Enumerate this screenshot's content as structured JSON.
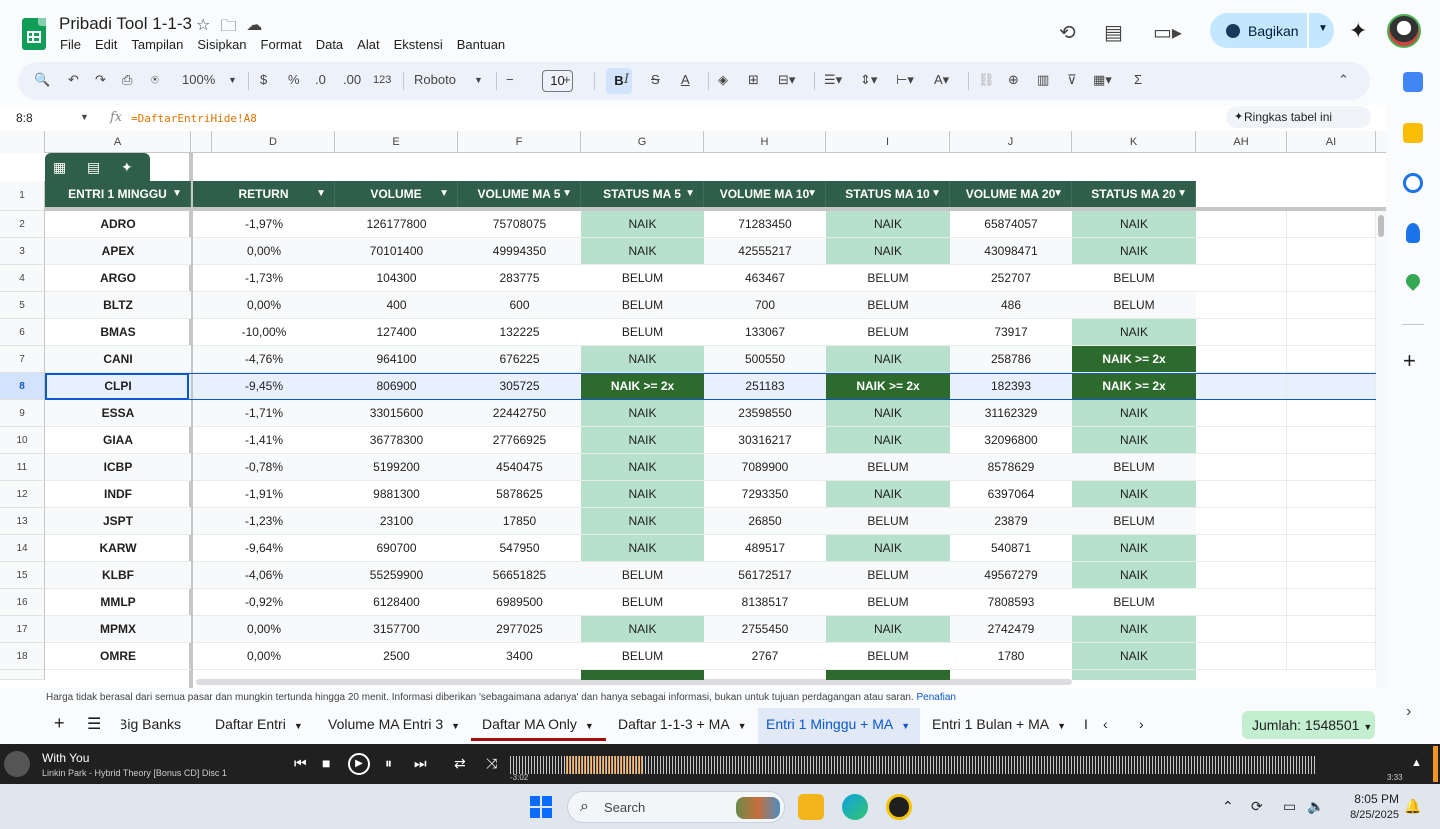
{
  "header": {
    "doc_title": "Pribadi Tool 1-1-3",
    "menu": [
      "File",
      "Edit",
      "Tampilan",
      "Sisipkan",
      "Format",
      "Data",
      "Alat",
      "Ekstensi",
      "Bantuan"
    ],
    "share_label": "Bagikan"
  },
  "toolbar": {
    "zoom": "100%",
    "currency": "$",
    "percent": "%",
    "dec_decrease": ".0",
    "dec_increase": ".00",
    "more_formats": "123",
    "font": "Roboto",
    "font_size": "10",
    "bold": "B",
    "italic": "I",
    "strike": "S",
    "text_color": "A",
    "sigma": "Σ"
  },
  "formula_bar": {
    "name_box": "8:8",
    "fx": "fx",
    "formula": "=DaftarEntriHide!A8",
    "summarize_label": "Ringkas tabel ini"
  },
  "columns": [
    "A",
    "D",
    "E",
    "F",
    "G",
    "H",
    "I",
    "J",
    "K",
    "AH",
    "AI"
  ],
  "table": {
    "headers": [
      "ENTRI 1 MINGGU",
      "RETURN",
      "VOLUME",
      "VOLUME MA 5",
      "STATUS MA 5",
      "VOLUME MA 10",
      "STATUS MA 10",
      "VOLUME MA 20",
      "STATUS MA 20"
    ],
    "rows": [
      {
        "n": "2",
        "ticker": "ADRO",
        "ret": "-1,97%",
        "vol": "126177800",
        "ma5": "75708075",
        "s5": "NAIK",
        "ma10": "71283450",
        "s10": "NAIK",
        "ma20": "65874057",
        "s20": "NAIK"
      },
      {
        "n": "3",
        "ticker": "APEX",
        "ret": "0,00%",
        "vol": "70101400",
        "ma5": "49994350",
        "s5": "NAIK",
        "ma10": "42555217",
        "s10": "NAIK",
        "ma20": "43098471",
        "s20": "NAIK"
      },
      {
        "n": "4",
        "ticker": "ARGO",
        "ret": "-1,73%",
        "vol": "104300",
        "ma5": "283775",
        "s5": "BELUM",
        "ma10": "463467",
        "s10": "BELUM",
        "ma20": "252707",
        "s20": "BELUM"
      },
      {
        "n": "5",
        "ticker": "BLTZ",
        "ret": "0,00%",
        "vol": "400",
        "ma5": "600",
        "s5": "BELUM",
        "ma10": "700",
        "s10": "BELUM",
        "ma20": "486",
        "s20": "BELUM"
      },
      {
        "n": "6",
        "ticker": "BMAS",
        "ret": "-10,00%",
        "vol": "127400",
        "ma5": "132225",
        "s5": "BELUM",
        "ma10": "133067",
        "s10": "BELUM",
        "ma20": "73917",
        "s20": "NAIK"
      },
      {
        "n": "7",
        "ticker": "CANI",
        "ret": "-4,76%",
        "vol": "964100",
        "ma5": "676225",
        "s5": "NAIK",
        "ma10": "500550",
        "s10": "NAIK",
        "ma20": "258786",
        "s20": "NAIK >= 2x"
      },
      {
        "n": "8",
        "ticker": "CLPI",
        "ret": "-9,45%",
        "vol": "806900",
        "ma5": "305725",
        "s5": "NAIK >= 2x",
        "ma10": "251183",
        "s10": "NAIK >= 2x",
        "ma20": "182393",
        "s20": "NAIK >= 2x"
      },
      {
        "n": "9",
        "ticker": "ESSA",
        "ret": "-1,71%",
        "vol": "33015600",
        "ma5": "22442750",
        "s5": "NAIK",
        "ma10": "23598550",
        "s10": "NAIK",
        "ma20": "31162329",
        "s20": "NAIK"
      },
      {
        "n": "10",
        "ticker": "GIAA",
        "ret": "-1,41%",
        "vol": "36778300",
        "ma5": "27766925",
        "s5": "NAIK",
        "ma10": "30316217",
        "s10": "NAIK",
        "ma20": "32096800",
        "s20": "NAIK"
      },
      {
        "n": "11",
        "ticker": "ICBP",
        "ret": "-0,78%",
        "vol": "5199200",
        "ma5": "4540475",
        "s5": "NAIK",
        "ma10": "7089900",
        "s10": "BELUM",
        "ma20": "8578629",
        "s20": "BELUM"
      },
      {
        "n": "12",
        "ticker": "INDF",
        "ret": "-1,91%",
        "vol": "9881300",
        "ma5": "5878625",
        "s5": "NAIK",
        "ma10": "7293350",
        "s10": "NAIK",
        "ma20": "6397064",
        "s20": "NAIK"
      },
      {
        "n": "13",
        "ticker": "JSPT",
        "ret": "-1,23%",
        "vol": "23100",
        "ma5": "17850",
        "s5": "NAIK",
        "ma10": "26850",
        "s10": "BELUM",
        "ma20": "23879",
        "s20": "BELUM"
      },
      {
        "n": "14",
        "ticker": "KARW",
        "ret": "-9,64%",
        "vol": "690700",
        "ma5": "547950",
        "s5": "NAIK",
        "ma10": "489517",
        "s10": "NAIK",
        "ma20": "540871",
        "s20": "NAIK"
      },
      {
        "n": "15",
        "ticker": "KLBF",
        "ret": "-4,06%",
        "vol": "55259900",
        "ma5": "56651825",
        "s5": "BELUM",
        "ma10": "56172517",
        "s10": "BELUM",
        "ma20": "49567279",
        "s20": "NAIK"
      },
      {
        "n": "16",
        "ticker": "MMLP",
        "ret": "-0,92%",
        "vol": "6128400",
        "ma5": "6989500",
        "s5": "BELUM",
        "ma10": "8138517",
        "s10": "BELUM",
        "ma20": "7808593",
        "s20": "BELUM"
      },
      {
        "n": "17",
        "ticker": "MPMX",
        "ret": "0,00%",
        "vol": "3157700",
        "ma5": "2977025",
        "s5": "NAIK",
        "ma10": "2755450",
        "s10": "NAIK",
        "ma20": "2742479",
        "s20": "NAIK"
      },
      {
        "n": "18",
        "ticker": "OMRE",
        "ret": "0,00%",
        "vol": "2500",
        "ma5": "3400",
        "s5": "BELUM",
        "ma10": "2767",
        "s10": "BELUM",
        "ma20": "1780",
        "s20": "NAIK"
      }
    ]
  },
  "disclaimer": {
    "text": "Harga tidak berasal dari semua pasar dan mungkin tertunda hingga 20 menit. Informasi diberikan 'sebagaimana adanya' dan hanya sebagai informasi, bukan untuk tujuan perdagangan atau saran.",
    "link": "Penafian"
  },
  "sheets": {
    "tabs": [
      "Big Banks",
      "Daftar Entri",
      "Volume MA Entri 3",
      "Daftar MA Only",
      "Daftar 1-1-3 + MA",
      "Entri 1 Minggu + MA",
      "Entri 1 Bulan + MA",
      "I"
    ],
    "active": "Entri 1 Minggu + MA",
    "sum_label": "Jumlah: 1548501"
  },
  "player": {
    "song": "With You",
    "artist": "Linkin Park - Hybrid Theory [Bonus CD] Disc 1",
    "elapsed": "-3:02",
    "total": "3:33"
  },
  "taskbar": {
    "search_label": "Search",
    "time": "8:05 PM",
    "date": "8/25/2025"
  },
  "colors": {
    "header_green": "#2f5f4b",
    "naik": "#b7e1cd",
    "naik_2x": "#2d6a2e",
    "selection": "#0b57d0"
  }
}
